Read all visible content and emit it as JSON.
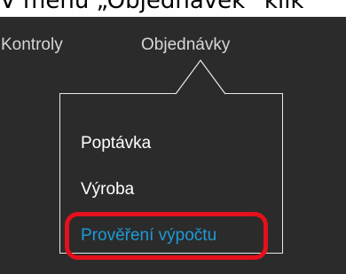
{
  "caption": "V menu „Objednávek“ klik",
  "topnav": {
    "items": [
      {
        "label": "Kontroly"
      },
      {
        "label": "Objednávky"
      }
    ]
  },
  "dropdown": {
    "items": [
      {
        "label": "Poptávka"
      },
      {
        "label": "Výroba"
      },
      {
        "label": "Prověření výpočtu",
        "highlighted": true
      }
    ]
  },
  "colors": {
    "background": "#2b2b2b",
    "nav_text": "#d6d6d6",
    "menu_text": "#ffffff",
    "active_text": "#1e9ad6",
    "highlight_border": "#e4101b"
  }
}
